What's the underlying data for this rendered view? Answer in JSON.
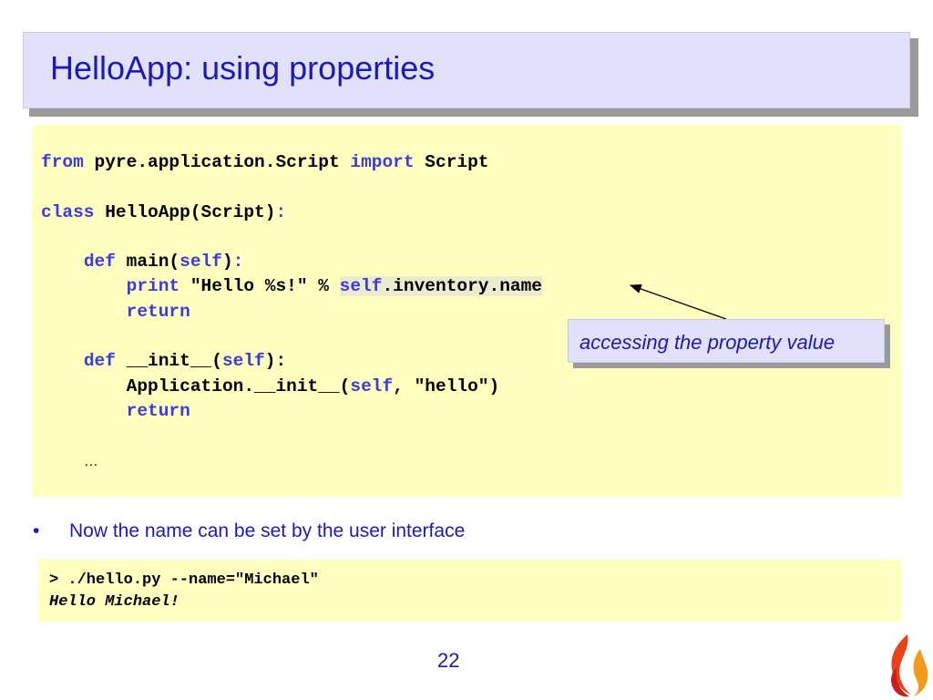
{
  "slide": {
    "title": "HelloApp: using properties",
    "page_number": "22"
  },
  "code": {
    "l1_kw_from": "from",
    "l1_module": " pyre.application.Script ",
    "l1_kw_import": "import",
    "l1_name": " Script",
    "l3_kw_class": "class",
    "l3_name": " HelloApp(Script)",
    "colon": ":",
    "l5_kw_def": "def",
    "l5_name": " main(",
    "self": "self",
    "l5_close": ")",
    "l6_kw_print": "print",
    "l6_string": " \"Hello %s!\" % ",
    "l6_attr": ".inventory.name",
    "kw_return": "return",
    "l9_kw_def": "def",
    "l9_name": " __init__(",
    "l9_close": "):",
    "l10_call": "Application.__init__(",
    "l10_args": ", \"hello\")",
    "ellipsis": "…"
  },
  "callout": {
    "text": "accessing the property value"
  },
  "bullets": [
    {
      "marker": "•",
      "text": "Now the name can be set by the user interface"
    }
  ],
  "terminal": {
    "command": "> ./hello.py --name=\"Michael\"",
    "output": "Hello Michael!"
  },
  "colors": {
    "title_text": "#1a1ab8",
    "keyword": "#3a3ae6",
    "code_bg": "#ffffc0",
    "title_bg": "#e1e1fb"
  },
  "icons": {
    "logo": "flame-logo-icon"
  }
}
